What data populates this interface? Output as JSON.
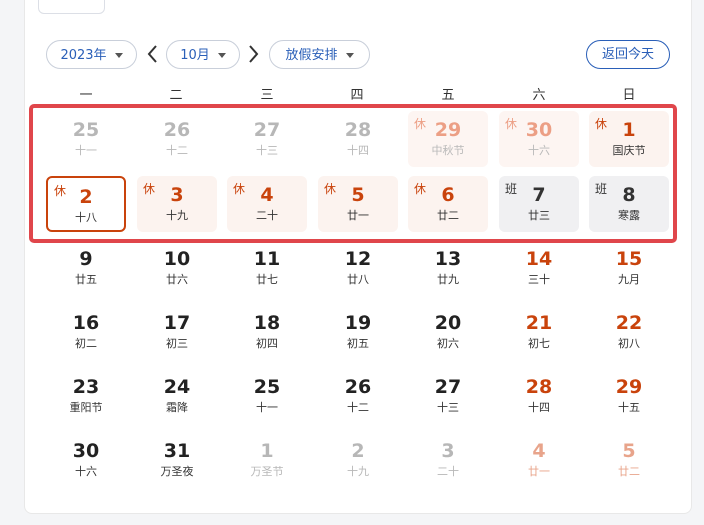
{
  "toolbar": {
    "year": "2023年",
    "month": "10月",
    "holiday": "放假安排",
    "return": "返回今天"
  },
  "weekdays": [
    "一",
    "二",
    "三",
    "四",
    "五",
    "六",
    "日"
  ],
  "colors": {
    "accent": "#2a5fb8",
    "holiday_red": "#c9430c",
    "frame": "#e0464b"
  },
  "rows": [
    [
      {
        "num": "25",
        "sub": "十一",
        "style": "c-grey",
        "tag": ""
      },
      {
        "num": "26",
        "sub": "十二",
        "style": "c-grey",
        "tag": ""
      },
      {
        "num": "27",
        "sub": "十三",
        "style": "c-grey",
        "tag": ""
      },
      {
        "num": "28",
        "sub": "十四",
        "style": "c-grey",
        "tag": ""
      },
      {
        "num": "29",
        "sub": "中秋节",
        "style": "bg-restfaded",
        "tag": "休"
      },
      {
        "num": "30",
        "sub": "十六",
        "style": "bg-restfaded",
        "tag": "休"
      },
      {
        "num": "1",
        "sub": "国庆节",
        "style": "bg-rest",
        "tag": "休"
      }
    ],
    [
      {
        "num": "2",
        "sub": "十八",
        "style": "bg-rest selected",
        "tag": "休"
      },
      {
        "num": "3",
        "sub": "十九",
        "style": "bg-rest",
        "tag": "休"
      },
      {
        "num": "4",
        "sub": "二十",
        "style": "bg-rest",
        "tag": "休"
      },
      {
        "num": "5",
        "sub": "廿一",
        "style": "bg-rest",
        "tag": "休"
      },
      {
        "num": "6",
        "sub": "廿二",
        "style": "bg-rest",
        "tag": "休"
      },
      {
        "num": "7",
        "sub": "廿三",
        "style": "bg-work",
        "tag": "班"
      },
      {
        "num": "8",
        "sub": "寒露",
        "style": "bg-work",
        "tag": "班"
      }
    ],
    [
      {
        "num": "9",
        "sub": "廿五",
        "style": "c-norm",
        "tag": ""
      },
      {
        "num": "10",
        "sub": "廿六",
        "style": "c-norm",
        "tag": ""
      },
      {
        "num": "11",
        "sub": "廿七",
        "style": "c-norm",
        "tag": ""
      },
      {
        "num": "12",
        "sub": "廿八",
        "style": "c-norm",
        "tag": ""
      },
      {
        "num": "13",
        "sub": "廿九",
        "style": "c-norm",
        "tag": ""
      },
      {
        "num": "14",
        "sub": "三十",
        "style": "c-red",
        "tag": ""
      },
      {
        "num": "15",
        "sub": "九月",
        "style": "c-red",
        "tag": ""
      }
    ],
    [
      {
        "num": "16",
        "sub": "初二",
        "style": "c-norm",
        "tag": ""
      },
      {
        "num": "17",
        "sub": "初三",
        "style": "c-norm",
        "tag": ""
      },
      {
        "num": "18",
        "sub": "初四",
        "style": "c-norm",
        "tag": ""
      },
      {
        "num": "19",
        "sub": "初五",
        "style": "c-norm",
        "tag": ""
      },
      {
        "num": "20",
        "sub": "初六",
        "style": "c-norm",
        "tag": ""
      },
      {
        "num": "21",
        "sub": "初七",
        "style": "c-red",
        "tag": ""
      },
      {
        "num": "22",
        "sub": "初八",
        "style": "c-red",
        "tag": ""
      }
    ],
    [
      {
        "num": "23",
        "sub": "重阳节",
        "style": "c-norm",
        "tag": ""
      },
      {
        "num": "24",
        "sub": "霜降",
        "style": "c-norm",
        "tag": ""
      },
      {
        "num": "25",
        "sub": "十一",
        "style": "c-norm",
        "tag": ""
      },
      {
        "num": "26",
        "sub": "十二",
        "style": "c-norm",
        "tag": ""
      },
      {
        "num": "27",
        "sub": "十三",
        "style": "c-norm",
        "tag": ""
      },
      {
        "num": "28",
        "sub": "十四",
        "style": "c-red",
        "tag": ""
      },
      {
        "num": "29",
        "sub": "十五",
        "style": "c-red",
        "tag": ""
      }
    ],
    [
      {
        "num": "30",
        "sub": "十六",
        "style": "c-norm",
        "tag": ""
      },
      {
        "num": "31",
        "sub": "万圣夜",
        "style": "c-norm",
        "tag": ""
      },
      {
        "num": "1",
        "sub": "万圣节",
        "style": "c-grey",
        "tag": ""
      },
      {
        "num": "2",
        "sub": "十九",
        "style": "c-grey",
        "tag": ""
      },
      {
        "num": "3",
        "sub": "二十",
        "style": "c-grey",
        "tag": ""
      },
      {
        "num": "4",
        "sub": "廿一",
        "style": "c-fadered",
        "tag": ""
      },
      {
        "num": "5",
        "sub": "廿二",
        "style": "c-fadered",
        "tag": ""
      }
    ]
  ]
}
